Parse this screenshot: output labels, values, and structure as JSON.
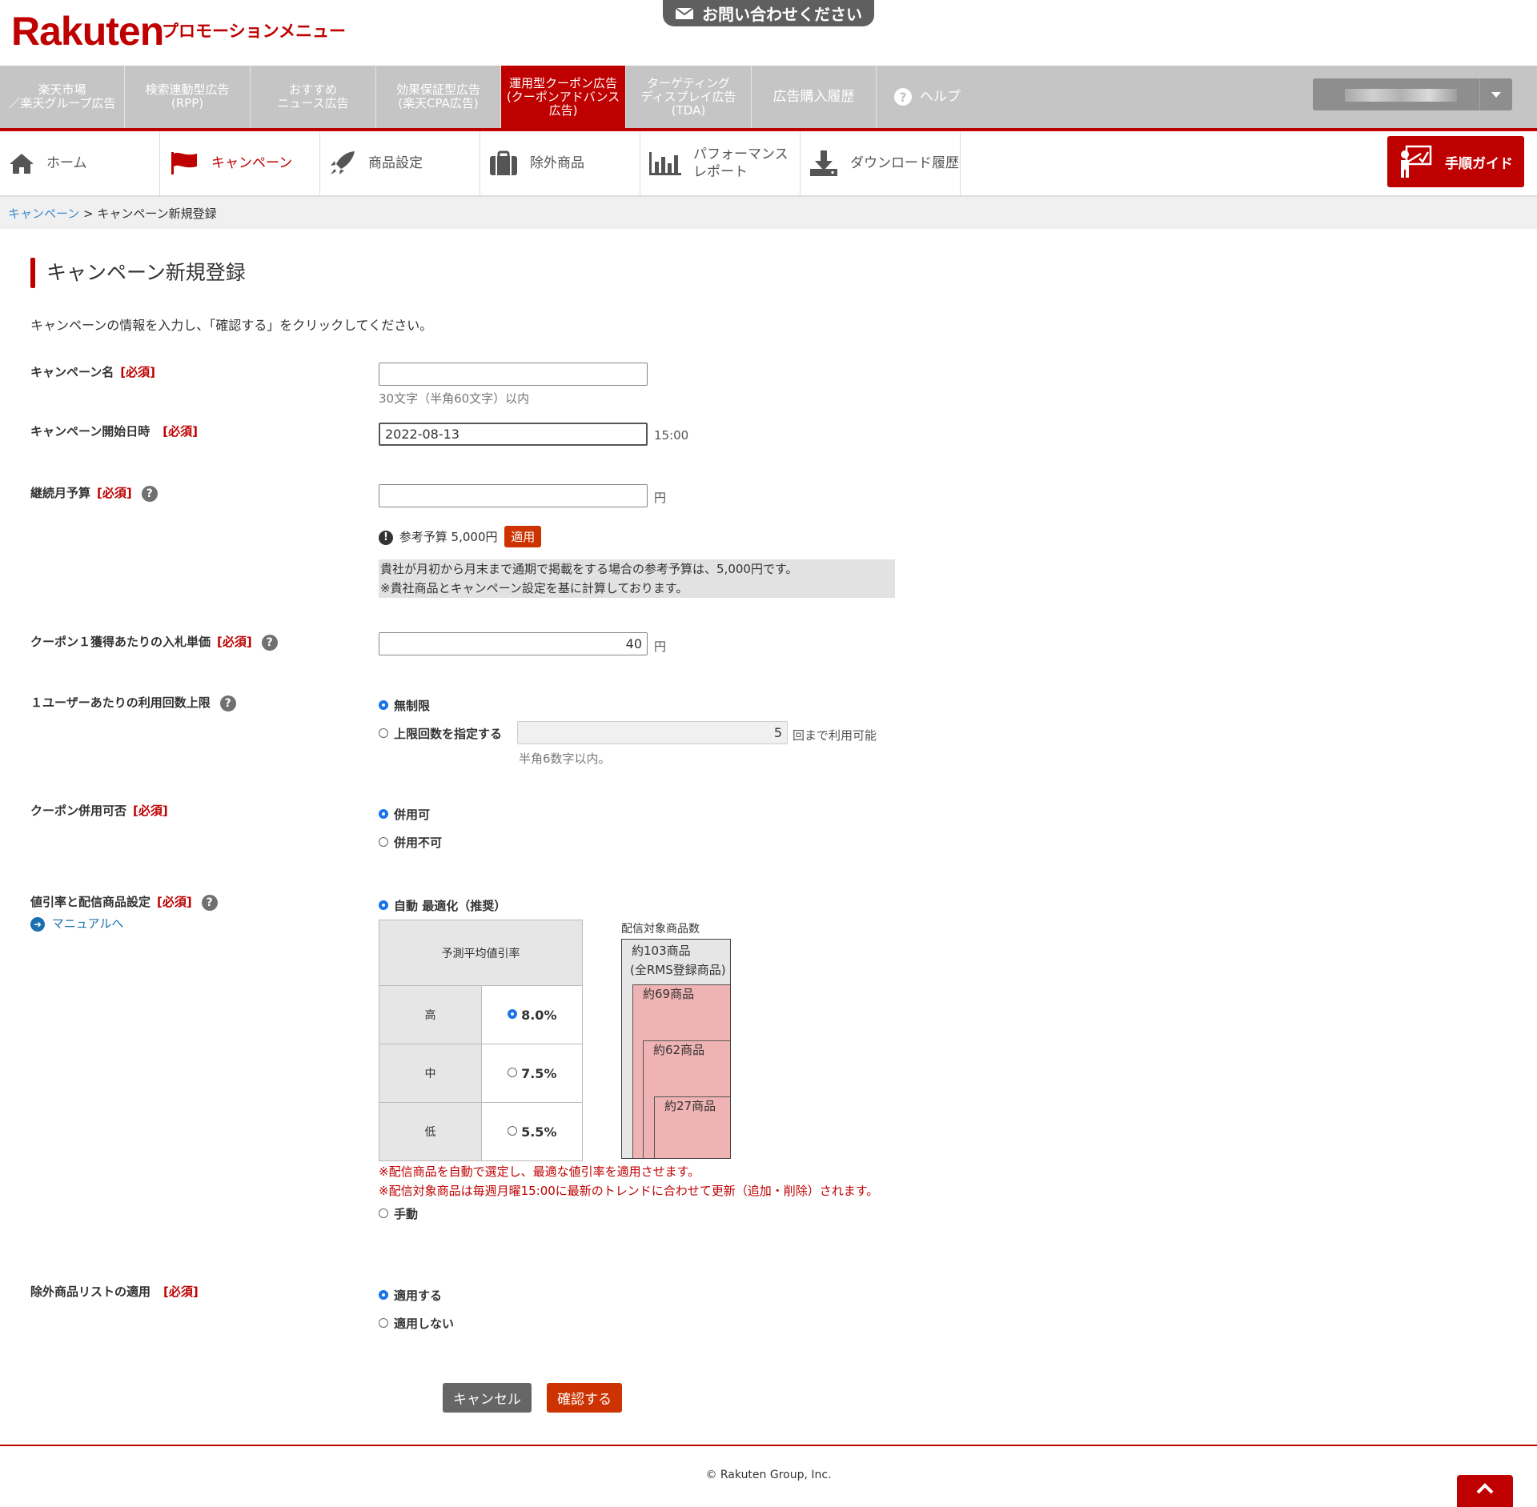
{
  "header": {
    "logo": "Rakuten",
    "app_title": "プロモーションメニュー",
    "contact_label": "お問い合わせください"
  },
  "top_nav": [
    {
      "label": "楽天市場\n／楽天グループ広告",
      "active": false
    },
    {
      "label": "検索連動型広告\n(RPP)",
      "active": false
    },
    {
      "label": "おすすめ\nニュース広告",
      "active": false
    },
    {
      "label": "効果保証型広告\n(楽天CPA広告)",
      "active": false
    },
    {
      "label": "運用型クーポン広告\n(クーポンアドバンス\n広告)",
      "active": true
    },
    {
      "label": "ターゲティング\nディスプレイ広告\n(TDA)",
      "active": false
    },
    {
      "label": "広告購入履歴",
      "active": false
    },
    {
      "label": "ヘルプ",
      "active": false
    }
  ],
  "sub_nav": [
    {
      "label": "ホーム",
      "icon": "home-icon"
    },
    {
      "label": "キャンペーン",
      "icon": "flag-icon"
    },
    {
      "label": "商品設定",
      "icon": "rocket-icon"
    },
    {
      "label": "除外商品",
      "icon": "suitcase-icon"
    },
    {
      "label": "パフォーマンス\nレポート",
      "icon": "bar-chart-icon"
    },
    {
      "label": "ダウンロード履歴",
      "icon": "download-icon"
    }
  ],
  "guide_button": "手順ガイド",
  "breadcrumb": {
    "parent": "キャンペーン",
    "separator": " > ",
    "current": "キャンペーン新規登録"
  },
  "page_title": "キャンペーン新規登録",
  "intro": "キャンペーンの情報を入力し、「確認する」をクリックしてください。",
  "required_tag": "[必須]",
  "form": {
    "campaign_name": {
      "label": "キャンペーン名",
      "value": "",
      "hint": "30文字（半角60文字）以内"
    },
    "start_date": {
      "label": "キャンペーン開始日時",
      "value": "2022-08-13",
      "time": "15:00"
    },
    "budget": {
      "label": "継続月予算",
      "value": "",
      "unit": "円",
      "reference": "参考予算 5,000円",
      "apply_label": "適用",
      "note_line1": "貴社が月初から月末まで通期で掲載をする場合の参考予算は、5,000円です。",
      "note_line2": "※貴社商品とキャンペーン設定を基に計算しております。"
    },
    "bid": {
      "label": "クーポン１獲得あたりの入札単価",
      "value": "40",
      "unit": "円"
    },
    "usage_limit": {
      "label": "１ユーザーあたりの利用回数上限",
      "option_unlimited": "無制限",
      "option_limit": "上限回数を指定する",
      "limit_value": "5",
      "limit_suffix": "回まで利用可能",
      "limit_hint": "半角6数字以内。",
      "selected": "unlimited"
    },
    "combine": {
      "label": "クーポン併用可否",
      "option_yes": "併用可",
      "option_no": "併用不可",
      "selected": "yes"
    },
    "discount": {
      "label": "値引率と配信商品設定",
      "manual_link": "マニュアルへ",
      "option_auto": "自動 最適化（推奨）",
      "option_manual": "手動",
      "selected": "auto",
      "table_header": "予測平均値引率",
      "rows": [
        {
          "level": "高",
          "rate": "8.0%",
          "selected": true
        },
        {
          "level": "中",
          "rate": "7.5%",
          "selected": false
        },
        {
          "level": "低",
          "rate": "5.5%",
          "selected": false
        }
      ],
      "products_title": "配信対象商品数",
      "products_all": "約103商品",
      "products_all_sub": "(全RMS登録商品)",
      "products_high": "約69商品",
      "products_mid": "約62商品",
      "products_low": "約27商品",
      "note1": "※配信商品を自動で選定し、最適な値引率を適用させます。",
      "note2": "※配信対象商品は毎週月曜15:00に最新のトレンドに合わせて更新（追加・削除）されます。"
    },
    "exclude": {
      "label": "除外商品リストの適用",
      "option_yes": "適用する",
      "option_no": "適用しない",
      "selected": "yes"
    }
  },
  "buttons": {
    "cancel": "キャンセル",
    "confirm": "確認する"
  },
  "footer": {
    "copyright": "© Rakuten Group, Inc."
  },
  "colors": {
    "brand": "#bf0000",
    "nav_gray": "#c5c5c5",
    "action": "#cc3300",
    "radio": "#1a73e8",
    "product_fill": "#f0b3b3"
  }
}
